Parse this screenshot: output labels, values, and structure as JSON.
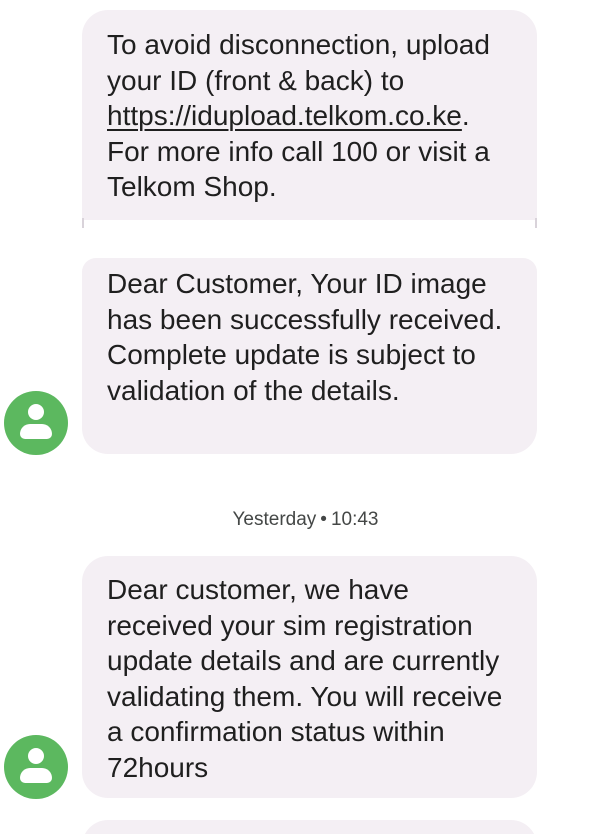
{
  "messages": [
    {
      "text_before_link": "To avoid disconnection, upload your ID (front & back) to ",
      "link": "https://idupload.telkom.co.ke",
      "text_after_link": ". For more info call 100 or visit a Telkom Shop."
    },
    {
      "text": "Dear Customer, Your ID image has been successfully received. Complete update is subject to validation of the details."
    },
    {
      "text": "Dear customer, we have received your sim registration update details and are currently validating them. You will receive a confirmation status within 72hours"
    }
  ],
  "timestamp": {
    "day": "Yesterday",
    "separator": "•",
    "time": "10:43"
  },
  "avatar": {
    "color": "#5cb85f",
    "icon": "person-icon"
  },
  "bubble_color": "#f4eff4"
}
